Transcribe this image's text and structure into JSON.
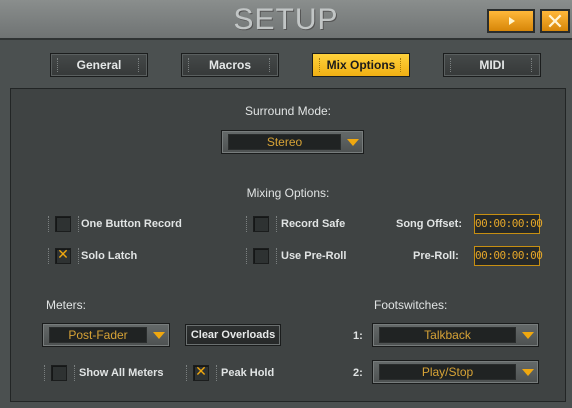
{
  "window": {
    "title": "SETUP",
    "play_icon": "play-triangle",
    "close_icon": "close-x",
    "close_glyph": "✕",
    "accent": "#f0a80f"
  },
  "tabs": [
    {
      "label": "General",
      "active": false
    },
    {
      "label": "Macros",
      "active": false
    },
    {
      "label": "Mix Options",
      "active": true
    },
    {
      "label": "MIDI",
      "active": false
    }
  ],
  "surround": {
    "label": "Surround Mode:",
    "value": "Stereo"
  },
  "mixing": {
    "label": "Mixing Options:",
    "one_button_record": {
      "label": "One Button Record",
      "checked": false
    },
    "record_safe": {
      "label": "Record Safe",
      "checked": false
    },
    "solo_latch": {
      "label": "Solo Latch",
      "checked": true,
      "mark": "✕"
    },
    "use_preroll": {
      "label": "Use Pre-Roll",
      "checked": false
    },
    "song_offset": {
      "label": "Song Offset:",
      "value": "00:00:00:00"
    },
    "preroll": {
      "label": "Pre-Roll:",
      "value": "00:00:00:00"
    }
  },
  "meters": {
    "label": "Meters:",
    "mode": "Post-Fader",
    "clear_label": "Clear Overloads",
    "show_all": {
      "label": "Show All Meters",
      "checked": false
    },
    "peak_hold": {
      "label": "Peak Hold",
      "checked": true,
      "mark": "✕"
    }
  },
  "footswitches": {
    "label": "Footswitches:",
    "items": [
      {
        "num": "1:",
        "value": "Talkback"
      },
      {
        "num": "2:",
        "value": "Play/Stop"
      }
    ]
  }
}
